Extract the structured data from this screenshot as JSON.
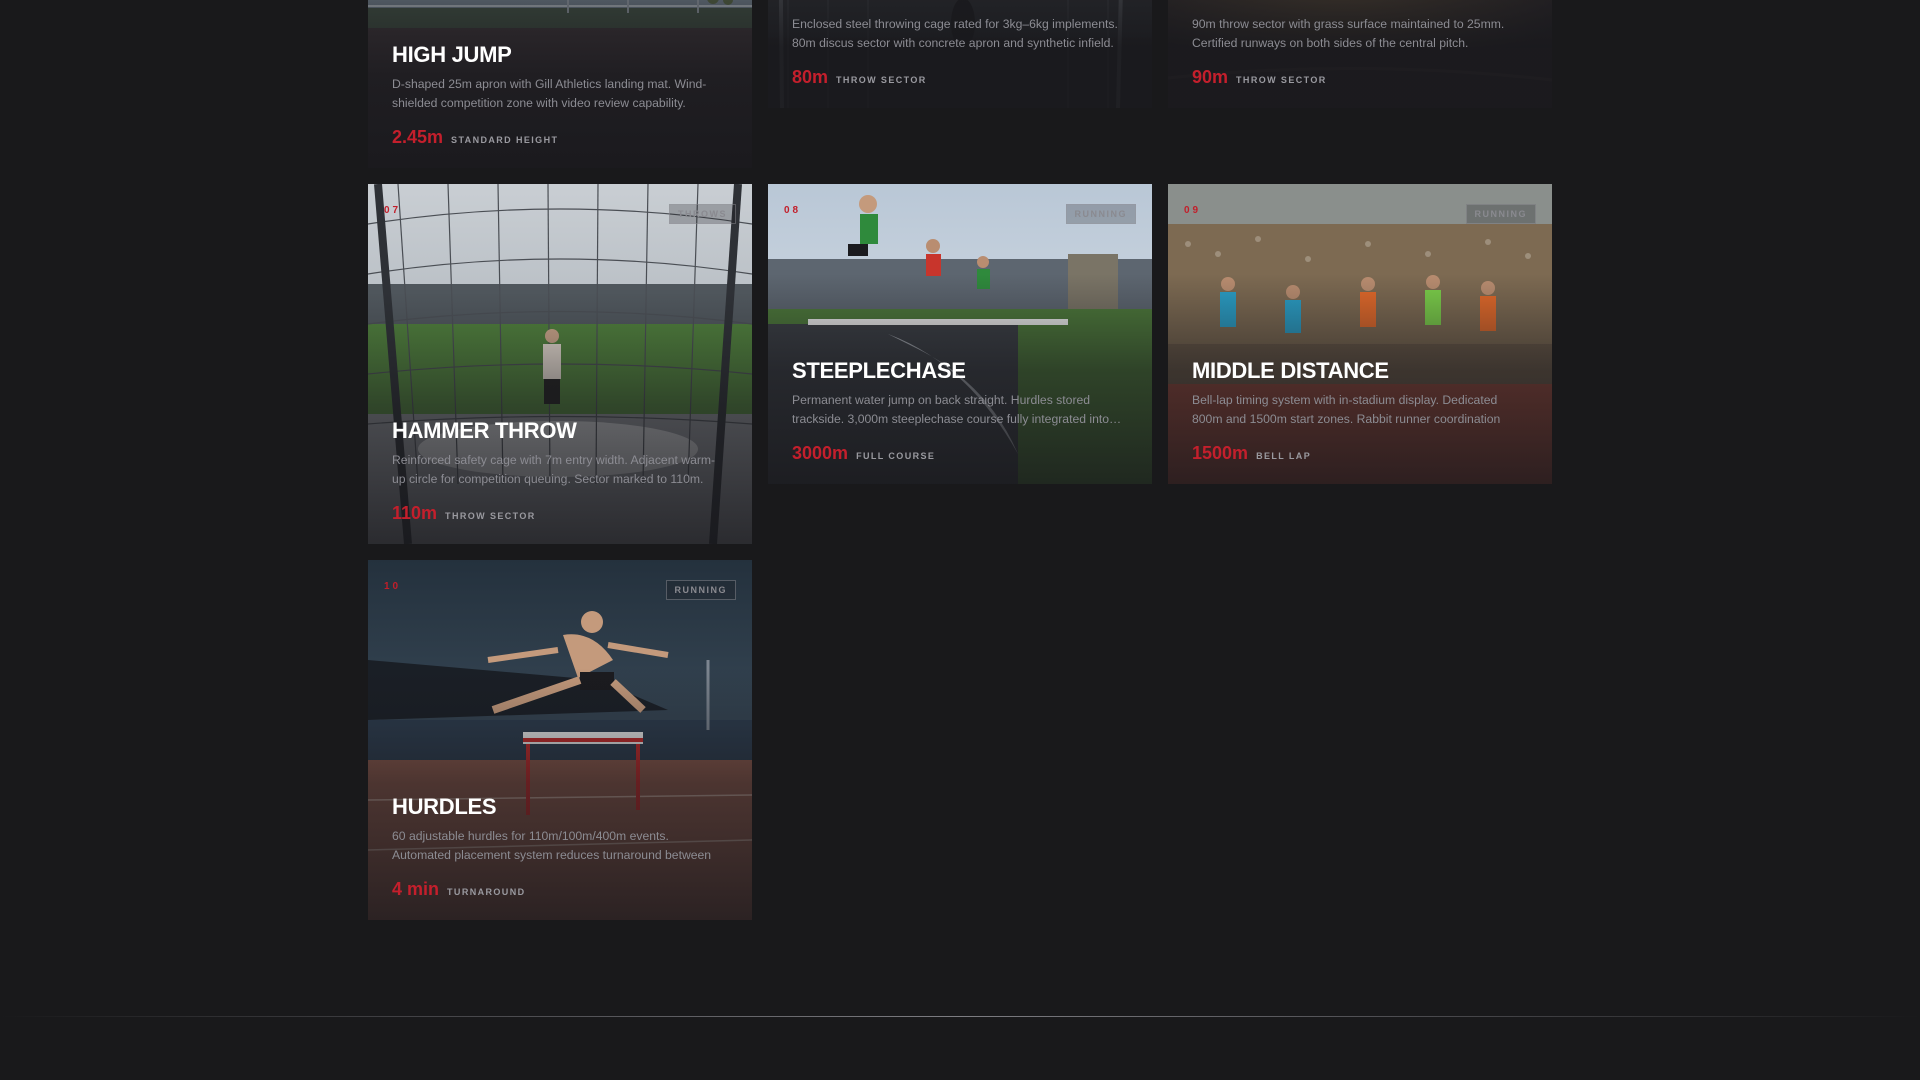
{
  "cards": [
    {
      "title": "HIGH JUMP",
      "desc": "D-shaped 25m apron with Gill Athletics landing mat. Wind-shielded competition zone with video review capability.",
      "value": "2.45m",
      "label": "STANDARD HEIGHT"
    },
    {
      "desc": "Enclosed steel throwing cage rated for 3kg–6kg implements. 80m discus sector with concrete apron and synthetic infield.",
      "value": "80m",
      "label": "THROW SECTOR"
    },
    {
      "desc": "90m throw sector with grass surface maintained to 25mm. Certified runways on both sides of the central pitch.",
      "value": "90m",
      "label": "THROW SECTOR"
    },
    {
      "num": "07",
      "tag": "THROWS",
      "title": "HAMMER THROW",
      "desc": "Reinforced safety cage with 7m entry width. Adjacent warm-up circle for competition queuing. Sector marked to 110m.",
      "value": "110m",
      "label": "THROW SECTOR"
    },
    {
      "num": "08",
      "tag": "RUNNING",
      "title": "STEEPLECHASE",
      "desc": "Permanent water jump on back straight. Hurdles stored trackside. 3,000m steeplechase course fully integrated into…",
      "value": "3000m",
      "label": "FULL COURSE"
    },
    {
      "num": "09",
      "tag": "RUNNING",
      "title": "MIDDLE DISTANCE",
      "desc": "Bell-lap timing system with in-stadium display. Dedicated 800m and 1500m start zones. Rabbit runner coordination system.",
      "value": "1500m",
      "label": "BELL LAP"
    },
    {
      "num": "10",
      "tag": "RUNNING",
      "title": "HURDLES",
      "desc": "60 adjustable hurdles for 110m/100m/400m events. Automated placement system reduces turnaround between events to…",
      "value": "4 min",
      "label": "TURNAROUND"
    }
  ],
  "colors": {
    "accent": "#c41f2c",
    "bg": "#19191b"
  }
}
